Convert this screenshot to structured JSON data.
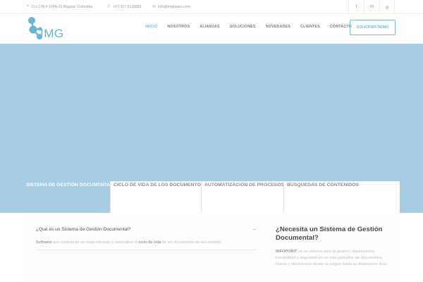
{
  "topbar": {
    "address": "Cra 17A # 103A-21 Bogotá, Colombia",
    "phone": "+57 317 5139985",
    "email": "info@imglatam.com",
    "social": [
      {
        "icon": "facebook-icon",
        "glyph": "f"
      },
      {
        "icon": "linkedin-icon",
        "glyph": "in"
      },
      {
        "icon": "instagram-icon",
        "glyph": "◎"
      }
    ]
  },
  "header": {
    "logo_text": "IMG",
    "nav": [
      "INICIO",
      "NOSOTROS",
      "ALIANZAS",
      "SOLUCIONES",
      "NOVEDADES",
      "CLIENTES",
      "CONTACTO"
    ],
    "cta": "SOLICITAR DEMO"
  },
  "tabs": [
    "SISTEMA DE GESTIÓN DOCUMENTAL",
    "CICLO DE VIDA DE LOS DOCUMENTOS",
    "AUTOMATIZACIÓN DE PROCESOS",
    "BÚSQUEDAS DE CONTENIDOS"
  ],
  "accordion": {
    "question": "¿Qué es un Sistema de Gestión Documental?",
    "toggle": "–",
    "answer_b1": "Software",
    "answer_t1": " que controla de un modo eficiente y sistemático el ",
    "answer_b2": "ciclo de vida",
    "answer_t2": " de los documentos de una entidad."
  },
  "sidebar": {
    "title": "¿Necesita un Sistema de Gestión Documental?",
    "bold": "INFOPOINT",
    "text": " es un sistema para la gestión, organización, trazabilidad y seguridad en un solo aplicativo de documentos físicos y electrónicos desde su origen hasta su disposición final."
  },
  "colors": {
    "accent": "#78b9d6",
    "hero": "#a6cde2"
  }
}
